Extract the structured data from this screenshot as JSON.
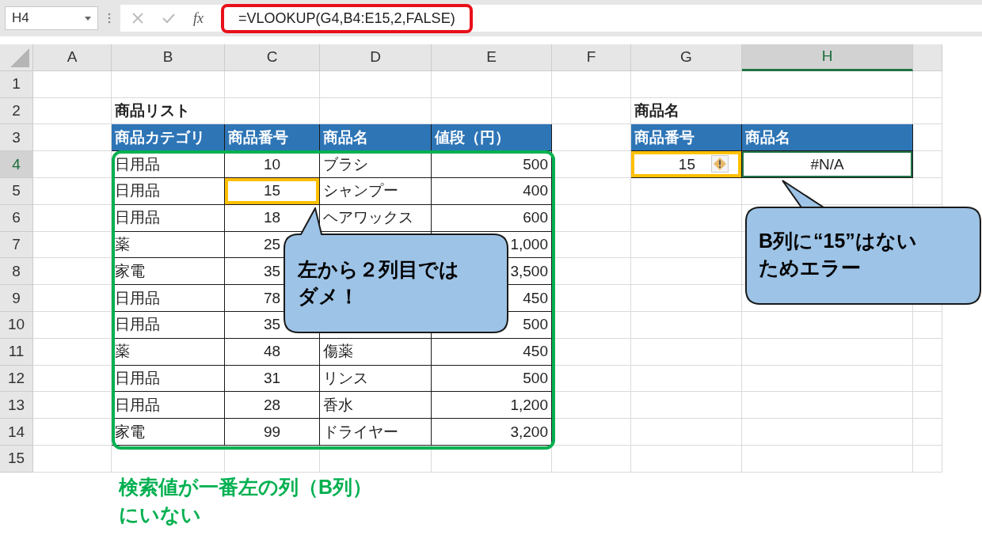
{
  "formula_bar": {
    "name_box": "H4",
    "function_label": "fx",
    "formula": "=VLOOKUP(G4,B4:E15,2,FALSE)",
    "formula_highlighted": true
  },
  "column_headers": [
    {
      "label": "A",
      "selected": false
    },
    {
      "label": "B",
      "selected": false
    },
    {
      "label": "C",
      "selected": false
    },
    {
      "label": "D",
      "selected": false
    },
    {
      "label": "E",
      "selected": false
    },
    {
      "label": "F",
      "selected": false
    },
    {
      "label": "G",
      "selected": false
    },
    {
      "label": "H",
      "selected": true
    }
  ],
  "row_numbers": [
    {
      "label": "1",
      "selected": false
    },
    {
      "label": "2",
      "selected": false
    },
    {
      "label": "3",
      "selected": false
    },
    {
      "label": "4",
      "selected": true
    },
    {
      "label": "5",
      "selected": false
    },
    {
      "label": "6",
      "selected": false
    },
    {
      "label": "7",
      "selected": false
    },
    {
      "label": "8",
      "selected": false
    },
    {
      "label": "9",
      "selected": false
    },
    {
      "label": "10",
      "selected": false
    },
    {
      "label": "11",
      "selected": false
    },
    {
      "label": "12",
      "selected": false
    },
    {
      "label": "13",
      "selected": false
    },
    {
      "label": "14",
      "selected": false
    },
    {
      "label": "15",
      "selected": false
    }
  ],
  "product_list": {
    "title": "商品リスト",
    "columns": [
      "商品カテゴリ",
      "商品番号",
      "商品名",
      "値段（円）"
    ],
    "rows": [
      {
        "category": "日用品",
        "number": "10",
        "name": "ブラシ",
        "price": "500",
        "number_highlighted": false
      },
      {
        "category": "日用品",
        "number": "15",
        "name": "シャンプー",
        "price": "400",
        "number_highlighted": true
      },
      {
        "category": "日用品",
        "number": "18",
        "name": "ヘアワックス",
        "price": "600",
        "number_highlighted": false
      },
      {
        "category": "薬",
        "number": "25",
        "price": "1,000",
        "number_highlighted": false
      },
      {
        "category": "家電",
        "number": "35",
        "price": "3,500",
        "number_highlighted": false
      },
      {
        "category": "日用品",
        "number": "78",
        "price": "450",
        "number_highlighted": false
      },
      {
        "category": "日用品",
        "number": "35",
        "price": "500",
        "number_highlighted": false
      },
      {
        "category": "薬",
        "number": "48",
        "name": "傷薬",
        "price": "450",
        "number_highlighted": false
      },
      {
        "category": "日用品",
        "number": "31",
        "name": "リンス",
        "price": "500",
        "number_highlighted": false
      },
      {
        "category": "日用品",
        "number": "28",
        "name": "香水",
        "price": "1,200",
        "number_highlighted": false
      },
      {
        "category": "家電",
        "number": "99",
        "name": "ドライヤー",
        "price": "3,200",
        "number_highlighted": false
      }
    ]
  },
  "lookup": {
    "title": "商品名",
    "columns": [
      "商品番号",
      "商品名"
    ],
    "row": {
      "number": "15",
      "name": "#N/A",
      "number_highlighted": true,
      "error_indicator": true,
      "selected": true
    }
  },
  "callouts": [
    {
      "text": "左から２列目ではダメ！"
    },
    {
      "text": "B列に“15”はないためエラー"
    }
  ],
  "note": "検索値が一番左の列（B列）にいない"
}
